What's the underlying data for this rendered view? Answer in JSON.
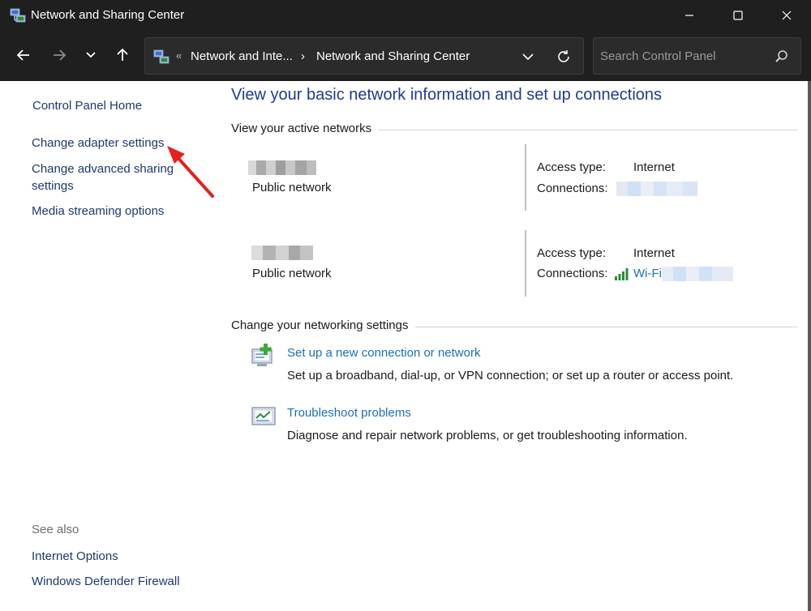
{
  "window": {
    "title": "Network and Sharing Center",
    "minimize_glyph": "—",
    "maximize_glyph": "☐",
    "close_glyph": "✕"
  },
  "navbar": {
    "breadcrumb_overflow": "«",
    "breadcrumbs": [
      "Network and Inte...",
      "Network and Sharing Center"
    ],
    "breadcrumb_separator": "›",
    "search_placeholder": "Search Control Panel"
  },
  "left_pane": {
    "home": "Control Panel Home",
    "links": [
      "Change adapter settings",
      "Change advanced sharing settings",
      "Media streaming options"
    ],
    "see_also_title": "See also",
    "see_also": [
      "Internet Options",
      "Windows Defender Firewall"
    ]
  },
  "main": {
    "title": "View your basic network information and set up connections",
    "active_networks_heading": "View your active networks",
    "networks": [
      {
        "type": "Public network",
        "access_label": "Access type:",
        "access_value": "Internet",
        "connections_label": "Connections:",
        "connection_link": ""
      },
      {
        "type": "Public network",
        "access_label": "Access type:",
        "access_value": "Internet",
        "connections_label": "Connections:",
        "connection_link": "Wi-Fi"
      }
    ],
    "change_heading": "Change your networking settings",
    "tasks": [
      {
        "link": "Set up a new connection or network",
        "description": "Set up a broadband, dial-up, or VPN connection; or set up a router or access point."
      },
      {
        "link": "Troubleshoot problems",
        "description": "Diagnose and repair network problems, or get troubleshooting information."
      }
    ]
  },
  "colors": {
    "chrome": "#1f1f1f",
    "link_blue": "#1c6fb5",
    "nav_link": "#1b3a6b",
    "title_blue": "#1e3c8c",
    "annotation_red": "#e0231e"
  },
  "icons": {
    "app": "network-center-icon",
    "task_1": "new-connection-icon",
    "task_2": "troubleshoot-icon",
    "wifi": "wifi-signal-icon"
  }
}
